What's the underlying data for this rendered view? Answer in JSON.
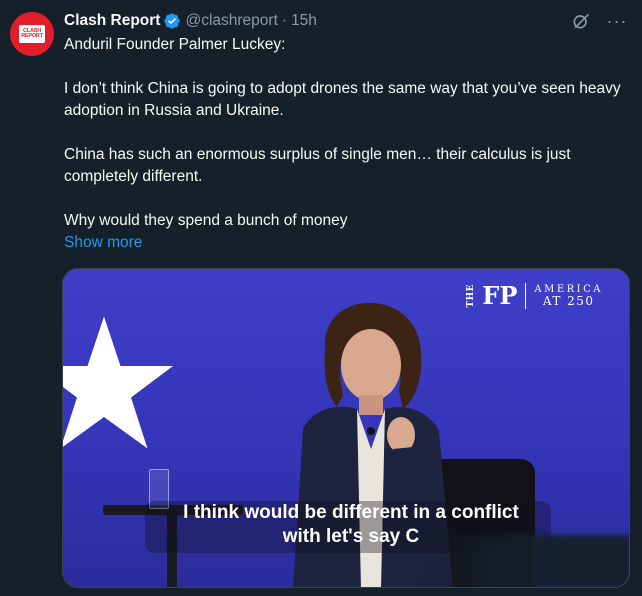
{
  "author": {
    "name": "Clash Report",
    "handle": "@clashreport",
    "separator": "·",
    "time": "15h",
    "avatar_text_line1": "CLASH",
    "avatar_text_line2": "REPORT"
  },
  "tweet": {
    "paragraphs": [
      "Anduril Founder Palmer Luckey:",
      "I don’t think China is going to adopt drones the same way that you’ve seen heavy adoption in Russia and Ukraine.",
      "China has such an enormous surplus of single men… their calculus is just completely different.",
      "Why would they spend a bunch of money"
    ],
    "show_more": "Show more"
  },
  "media": {
    "logo_the": "THE",
    "logo_fp": "FP",
    "logo_line1": "AMERICA",
    "logo_line2": "AT 250",
    "caption_line1": "I think would be different in a conflict",
    "caption_line2": "with let's say C"
  },
  "colors": {
    "background": "#15202b",
    "text": "#f7f9f9",
    "muted": "#8b98a5",
    "link": "#1d9bf0",
    "brand_red": "#e11d2a"
  },
  "icons": {
    "verified": "verified-badge-icon",
    "grok": "grok-icon",
    "more": "more-icon"
  }
}
